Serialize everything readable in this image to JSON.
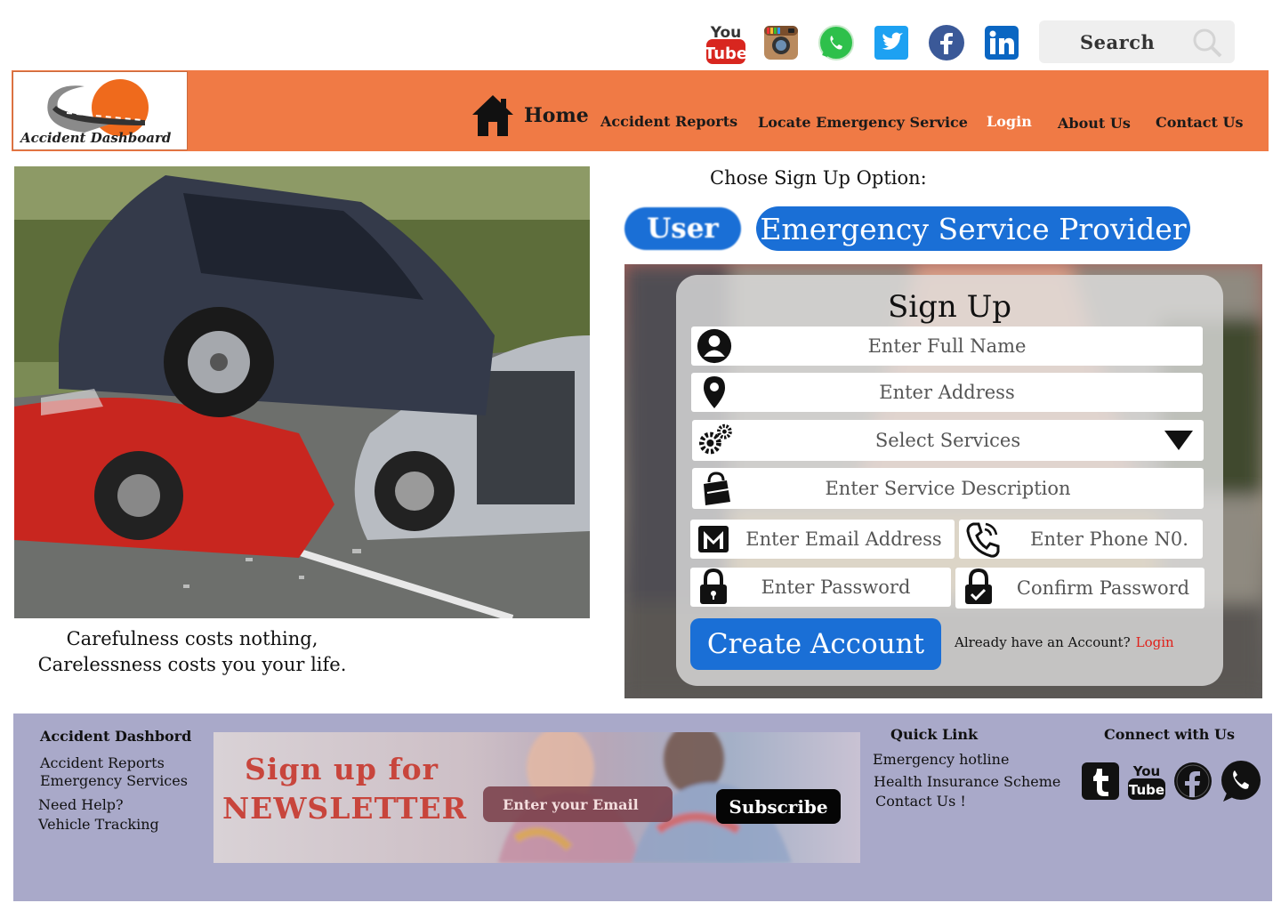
{
  "header": {
    "social_icons": [
      "youtube-icon",
      "instagram-icon",
      "whatsapp-icon",
      "twitter-icon",
      "facebook-icon",
      "linkedin-icon"
    ],
    "search_label": "Search"
  },
  "brand": {
    "logo_text": "Accident Dashboard"
  },
  "nav": {
    "home": "Home",
    "accident_reports": "Accident Reports",
    "locate_emergency": "Locate Emergency Service",
    "login": "Login",
    "about": "About Us",
    "contact": "Contact Us"
  },
  "hero": {
    "quote_line1": "Carefulness costs nothing,",
    "quote_line2": "Carelessness costs you your life."
  },
  "signup": {
    "option_label": "Chose Sign Up Option:",
    "option_user": "User",
    "option_provider": "Emergency Service Provider",
    "title": "Sign Up",
    "full_name": "Enter Full Name",
    "address": "Enter Address",
    "services": "Select Services",
    "description": "Enter Service Description",
    "email": "Enter Email Address",
    "phone": "Enter Phone N0.",
    "password": "Enter Password",
    "confirm_password": "Confirm Password",
    "create_button": "Create Account",
    "already_text": "Already have an Account?",
    "login_link": "Login"
  },
  "footer": {
    "brand_heading": "Accident Dashbord",
    "links": [
      "Accident Reports",
      "Emergency Services",
      "Need Help?",
      "Vehicle Tracking"
    ],
    "newsletter_line1": "Sign up for",
    "newsletter_line2": "NEWSLETTER",
    "newsletter_placeholder": "Enter your Email",
    "subscribe": "Subscribe",
    "quick_heading": "Quick Link",
    "quick_links": [
      "Emergency hotline",
      "Health Insurance Scheme",
      "Contact Us !"
    ],
    "connect_heading": "Connect with Us",
    "connect_icons": [
      "tumblr-icon",
      "youtube-icon",
      "facebook-icon",
      "whatsapp-icon"
    ]
  },
  "colors": {
    "nav_bg": "#f07a45",
    "primary_blue": "#1a6fd6",
    "footer_bg": "#a9a9c9",
    "login_red": "#e0201a",
    "newsletter_red": "#c8453c"
  }
}
